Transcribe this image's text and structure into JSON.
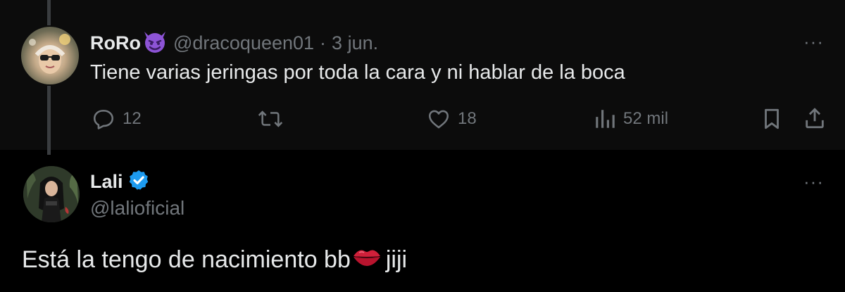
{
  "reply": {
    "author_name": "RoRo",
    "author_emoji": "😈",
    "author_handle": "@dracoqueen01",
    "separator": "·",
    "date": "3 jun.",
    "text": "Tiene varias jeringas por toda la cara y ni hablar de la boca",
    "more_label": "···",
    "actions": {
      "replies": "12",
      "retweets": "",
      "likes": "18",
      "views": "52 mil"
    }
  },
  "main": {
    "author_name": "Lali",
    "verified": true,
    "author_handle": "@lalioficial",
    "text": "Está la tengo de nacimiento bb",
    "text_emoji": "💋",
    "text_suffix": "jiji",
    "more_label": "···"
  },
  "icons": {
    "reply": "speech-bubble-icon",
    "retweet": "retweet-icon",
    "like": "heart-icon",
    "views": "bar-chart-icon",
    "bookmark": "bookmark-icon",
    "share": "share-icon",
    "verified": "verified-badge-icon",
    "devil": "devil-emoji-icon",
    "lips": "kiss-lips-emoji-icon"
  },
  "colors": {
    "background": "#000000",
    "reply_background": "#0c0c0c",
    "text_primary": "#e7e9ea",
    "text_secondary": "#71767b",
    "verified_blue": "#1d9bf0",
    "devil_purple": "#8d54d6",
    "lips_red": "#d0203a"
  }
}
